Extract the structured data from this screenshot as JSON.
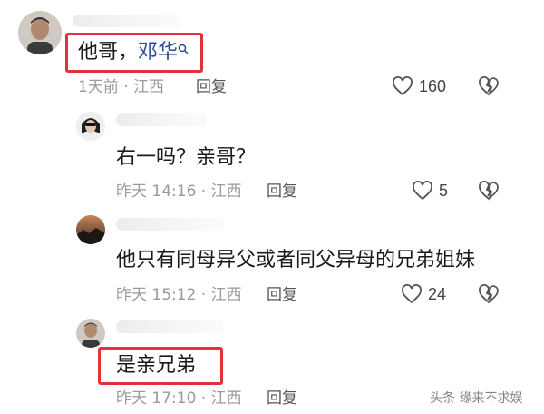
{
  "comments": [
    {
      "text_prefix": "他哥，",
      "mention": "邓华",
      "meta": "1天前 · 江西",
      "reply_label": "回复",
      "likes": "160"
    },
    {
      "text": "右一吗？亲哥？",
      "meta": "昨天 14:16 · 江西",
      "reply_label": "回复",
      "likes": "5"
    },
    {
      "text": "他只有同母异父或者同父异母的兄弟姐妹",
      "meta": "昨天 15:12 · 江西",
      "reply_label": "回复",
      "likes": "24"
    },
    {
      "text": "是亲兄弟",
      "meta": "昨天 17:10 · 江西",
      "reply_label": "回复"
    }
  ],
  "colors": {
    "highlight_box": "#e0333a",
    "mention": "#2a4d8f"
  },
  "icons": {
    "like": "heart-outline-icon",
    "dislike": "broken-heart-icon",
    "mention_search": "search-icon"
  },
  "watermark": "头条 缘来不求娱"
}
